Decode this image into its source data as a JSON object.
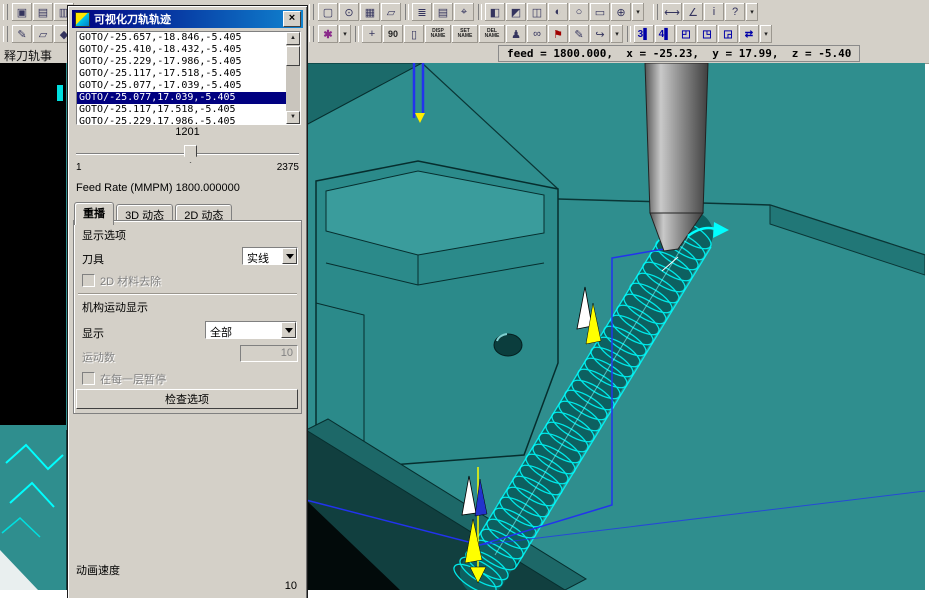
{
  "toolbar": {
    "dropdown_glyph": "▾",
    "row1_left": [
      {
        "name": "display-window-icon",
        "glyph": "▣"
      },
      {
        "name": "open-icon",
        "glyph": "▤"
      },
      {
        "name": "print-icon",
        "glyph": "▥"
      }
    ],
    "row1_right": [
      {
        "name": "selection-box-icon",
        "glyph": "▢"
      },
      {
        "name": "snap-point-icon",
        "glyph": "⊙"
      },
      {
        "name": "grid-icon",
        "glyph": "▦"
      },
      {
        "name": "work-plane-icon",
        "glyph": "▱"
      },
      {
        "name": "layer-settings-icon",
        "glyph": "≣"
      },
      {
        "name": "layer-visibility-icon",
        "glyph": "▤"
      },
      {
        "name": "wcs-icon",
        "glyph": "⌖"
      },
      {
        "name": "view-front-icon",
        "glyph": "◧"
      },
      {
        "name": "view-top-icon",
        "glyph": "◩"
      },
      {
        "name": "view-iso-icon",
        "glyph": "◫"
      },
      {
        "name": "shaded-display-icon",
        "glyph": "◐"
      },
      {
        "name": "wireframe-display-icon",
        "glyph": "○"
      },
      {
        "name": "fit-view-icon",
        "glyph": "▭"
      },
      {
        "name": "zoom-icon",
        "glyph": "⊕"
      }
    ],
    "row1_extra": [
      {
        "name": "measure-distance-icon",
        "glyph": "⟷"
      },
      {
        "name": "measure-angle-icon",
        "glyph": "∠"
      },
      {
        "name": "info-icon",
        "glyph": "i"
      },
      {
        "name": "help-icon",
        "glyph": "?"
      }
    ],
    "row2_left": [
      {
        "name": "sketch-icon",
        "glyph": "✎"
      },
      {
        "name": "datum-plane-icon",
        "glyph": "▱"
      },
      {
        "name": "feature-icon",
        "glyph": "◆"
      }
    ],
    "row2_right": [
      {
        "name": "refresh-icon",
        "glyph": "✱"
      },
      {
        "name": "pan-icon",
        "glyph": "+"
      },
      {
        "name": "rotate-view-90-icon",
        "glyph": "90"
      },
      {
        "name": "dynamic-view-icon",
        "glyph": "▯"
      },
      {
        "name": "display-name-button",
        "glyph": "DISP\nNAME"
      },
      {
        "name": "set-name-button",
        "glyph": "SET\nNAME"
      },
      {
        "name": "delete-name-button",
        "glyph": "DEL\nNAME"
      },
      {
        "name": "light-icon",
        "glyph": "♟"
      },
      {
        "name": "stereo-glasses-icon",
        "glyph": "∞"
      },
      {
        "name": "flag-icon",
        "glyph": "⚑"
      },
      {
        "name": "annotate-icon",
        "glyph": "✎"
      },
      {
        "name": "jump-arrow-icon",
        "glyph": "↪"
      }
    ],
    "row2_views": [
      {
        "name": "three-view-icon",
        "glyph": "3▌"
      },
      {
        "name": "four-view-icon",
        "glyph": "4▌"
      },
      {
        "name": "layout-tl-icon",
        "glyph": "◰"
      },
      {
        "name": "layout-tr-icon",
        "glyph": "◳"
      },
      {
        "name": "layout-br-icon",
        "glyph": "◲"
      },
      {
        "name": "swap-views-icon",
        "glyph": "⇄"
      }
    ]
  },
  "status_line": {
    "prompt": "释刀轨事",
    "readout": "feed = 1800.000,  x = -25.23,  y = 17.99,  z = -5.40"
  },
  "dialog": {
    "title": "可视化刀轨轨迹",
    "close_glyph": "×",
    "scroll_up_glyph": "▲",
    "scroll_down_glyph": "▼",
    "goto_list": [
      "GOTO/-25.657,-18.846,-5.405",
      "GOTO/-25.410,-18.432,-5.405",
      "GOTO/-25.229,-17.986,-5.405",
      "GOTO/-25.117,-17.518,-5.405",
      "GOTO/-25.077,-17.039,-5.405",
      "GOTO/-25.077,17.039,-5.405",
      "GOTO/-25.117,17.518,-5.405",
      "GOTO/-25.229,17.986,-5.405"
    ],
    "selected_index": 5,
    "slider": {
      "value": "1201",
      "min": "1",
      "max": "2375"
    },
    "feed_rate": "Feed Rate (MMPM) 1800.000000",
    "tabs": [
      "重播",
      "3D 动态",
      "2D 动态"
    ],
    "display_options_label": "显示选项",
    "tool_label": "刀具",
    "tool_value": "实线",
    "material_removal_label": "2D 材料去除",
    "mechanism_label": "机构运动显示",
    "show_label": "显示",
    "show_value": "全部",
    "motion_count_label": "运动数",
    "motion_count_value": "10",
    "pause_label": "在每一层暂停",
    "check_options_button": "检查选项",
    "animation_speed_label": "动画速度",
    "animation_speed_value": "10"
  },
  "viewport": {
    "colors": {
      "background": "#2f8e8e",
      "toolpath_cyan": "#00ffff",
      "tool_gray": "#9a9a9a",
      "marker_yellow": "#ffff00",
      "motion_line_blue": "#2233ee",
      "selection_blue": "#000080",
      "chrome_gray": "#d4d0c8"
    }
  }
}
